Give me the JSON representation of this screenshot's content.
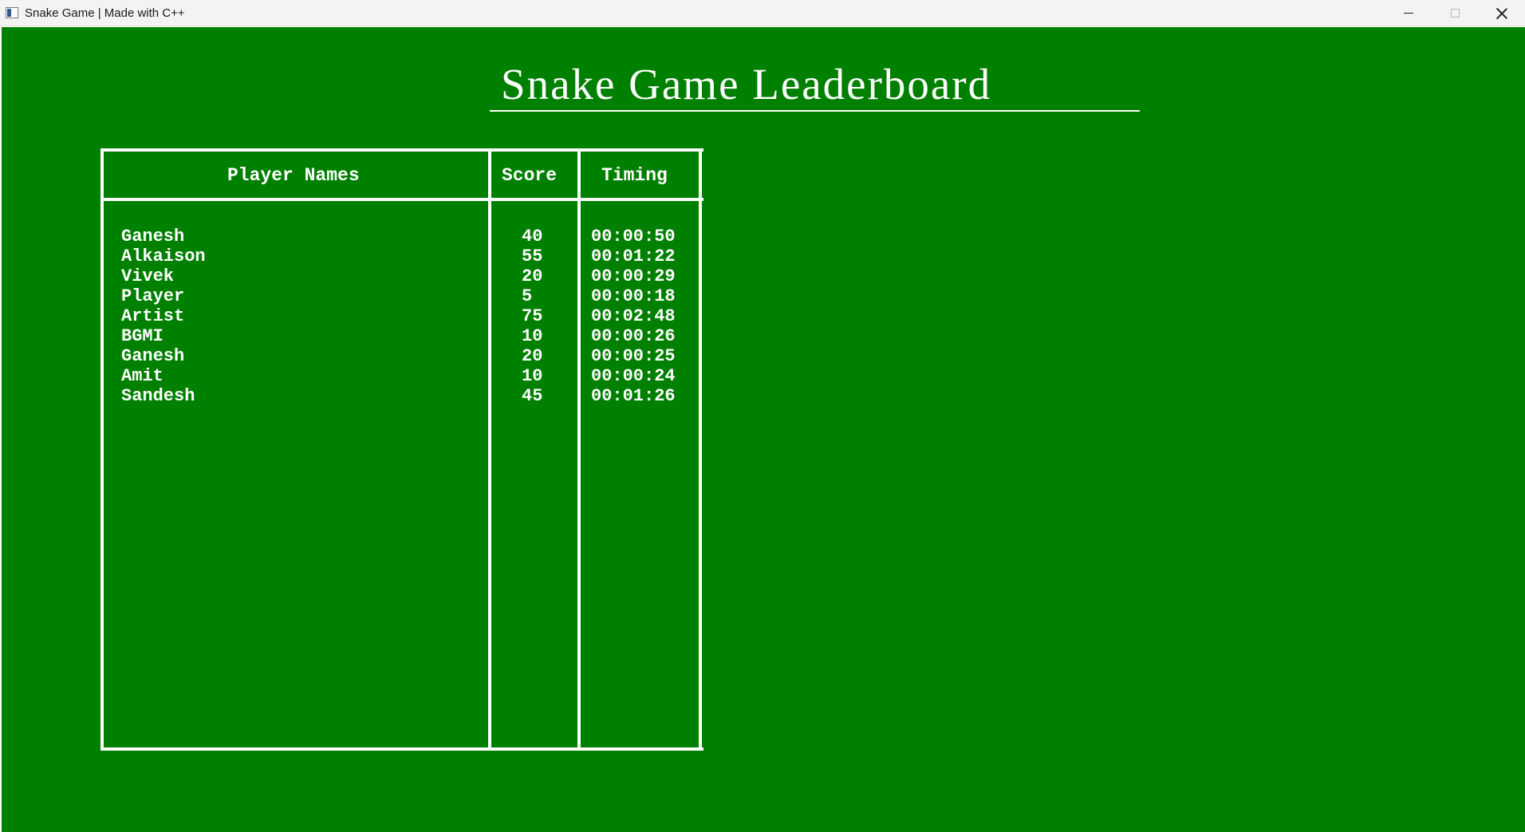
{
  "window": {
    "title": "Snake Game | Made with C++"
  },
  "leaderboard": {
    "title": "Snake Game Leaderboard",
    "headers": {
      "name": "Player Names",
      "score": "Score",
      "timing": "Timing"
    },
    "rows": [
      {
        "name": "Ganesh",
        "score": "40",
        "timing": "00:00:50"
      },
      {
        "name": "Alkaison",
        "score": "55",
        "timing": "00:01:22"
      },
      {
        "name": "Vivek",
        "score": "20",
        "timing": "00:00:29"
      },
      {
        "name": "Player",
        "score": "5",
        "timing": "00:00:18"
      },
      {
        "name": "Artist",
        "score": "75",
        "timing": "00:02:48"
      },
      {
        "name": "BGMI",
        "score": "10",
        "timing": "00:00:26"
      },
      {
        "name": "Ganesh",
        "score": "20",
        "timing": "00:00:25"
      },
      {
        "name": "Amit",
        "score": "10",
        "timing": "00:00:24"
      },
      {
        "name": "Sandesh",
        "score": "45",
        "timing": "00:01:26"
      }
    ]
  },
  "colors": {
    "background": "#008000",
    "foreground": "#ffffff"
  }
}
